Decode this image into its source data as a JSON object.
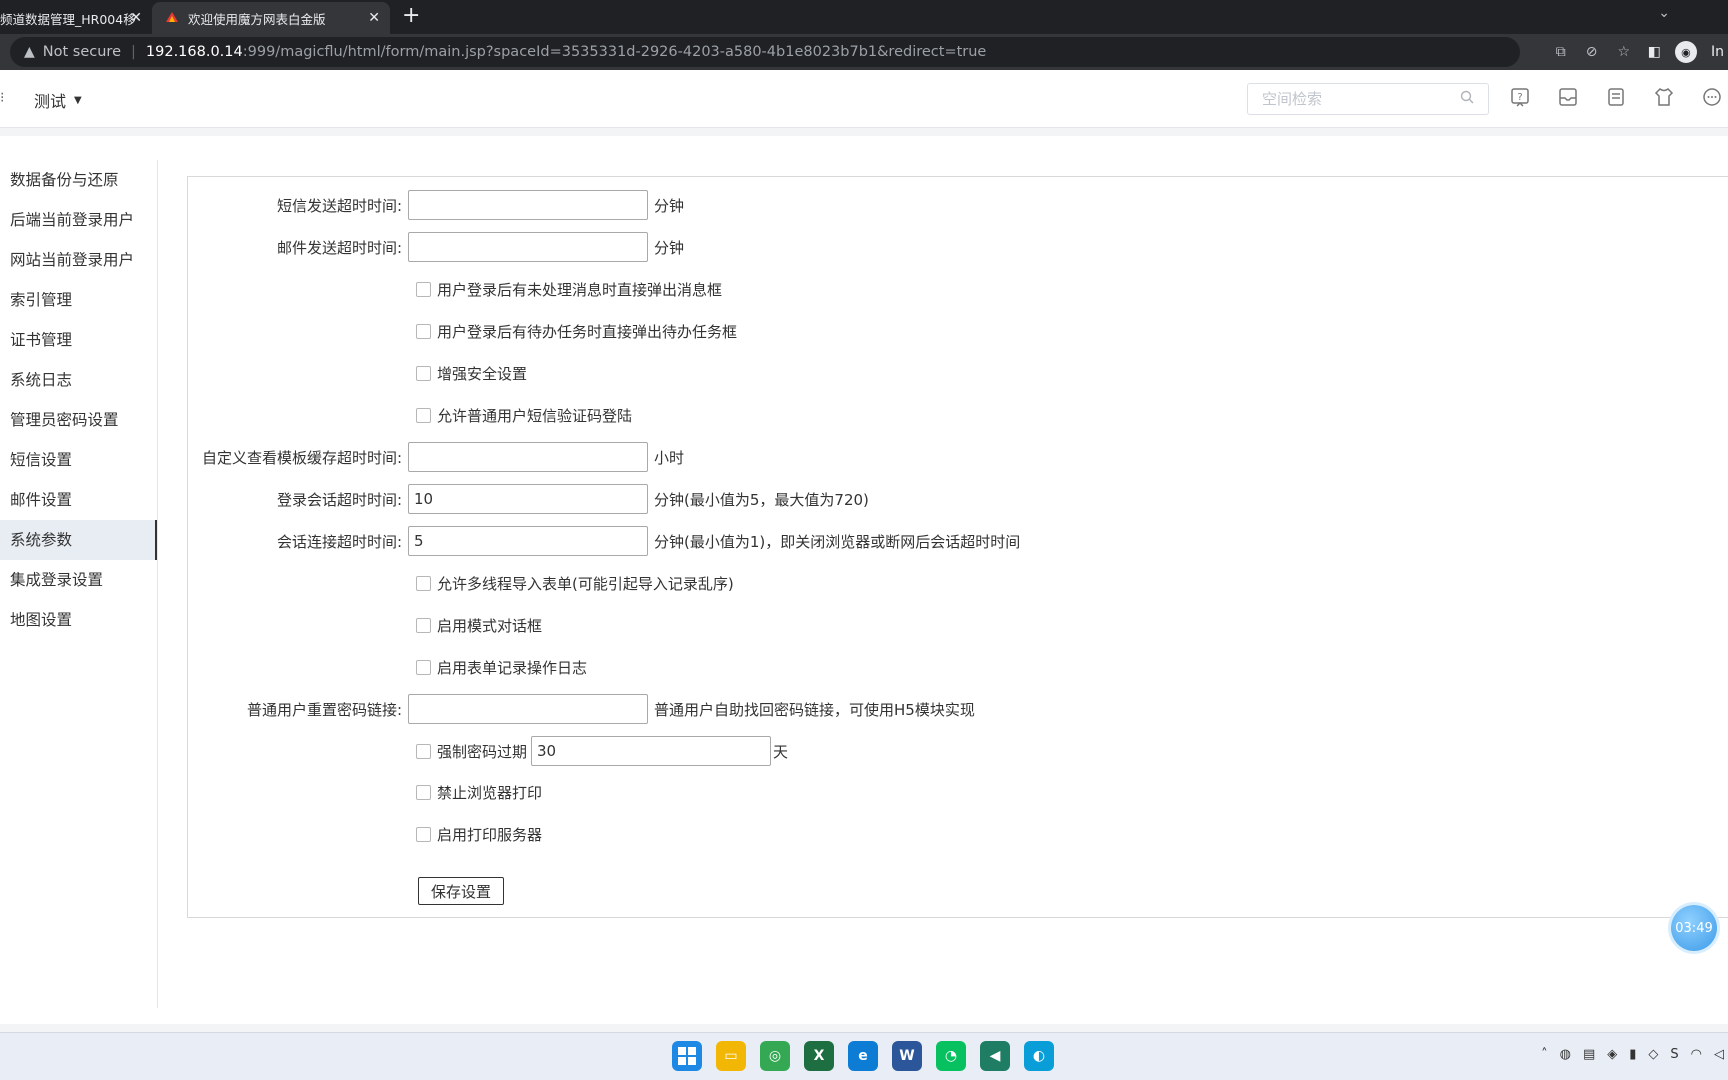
{
  "browser": {
    "tabs": [
      {
        "title": "频道数据管理_HR004移"
      },
      {
        "title": "欢迎使用魔方网表白金版"
      }
    ],
    "new_tab": "+",
    "address": {
      "security_label": "Not secure",
      "host": "192.168.0.14",
      "path": ":999/magicflu/html/form/main.jsp?spaceId=3535331d-2926-4203-a580-4b1e8023b7b1&redirect=true"
    },
    "profile_initial": "In"
  },
  "header": {
    "space_name": "测试",
    "search_placeholder": "空间检索"
  },
  "sidebar": {
    "items": [
      {
        "label": "数据备份与还原"
      },
      {
        "label": "后端当前登录用户"
      },
      {
        "label": "网站当前登录用户"
      },
      {
        "label": "索引管理"
      },
      {
        "label": "证书管理"
      },
      {
        "label": "系统日志"
      },
      {
        "label": "管理员密码设置"
      },
      {
        "label": "短信设置"
      },
      {
        "label": "邮件设置"
      },
      {
        "label": "系统参数"
      },
      {
        "label": "集成登录设置"
      },
      {
        "label": "地图设置"
      }
    ],
    "active": "系统参数"
  },
  "form": {
    "sms_timeout": {
      "label": "短信发送超时时间:",
      "value": "",
      "unit": "分钟"
    },
    "mail_timeout": {
      "label": "邮件发送超时时间:",
      "value": "",
      "unit": "分钟"
    },
    "popup_messages": {
      "label": "用户登录后有未处理消息时直接弹出消息框",
      "checked": false
    },
    "popup_tasks": {
      "label": "用户登录后有待办任务时直接弹出待办任务框",
      "checked": false
    },
    "enhanced_security": {
      "label": "增强安全设置",
      "checked": false
    },
    "sms_login": {
      "label": "允许普通用户短信验证码登陆",
      "checked": false
    },
    "template_cache": {
      "label": "自定义查看模板缓存超时时间:",
      "value": "",
      "unit": "小时"
    },
    "session_timeout": {
      "label": "登录会话超时时间:",
      "value": "10",
      "unit": "分钟(最小值为5，最大值为720)"
    },
    "connection_timeout": {
      "label": "会话连接超时时间:",
      "value": "5",
      "unit": "分钟(最小值为1)，即关闭浏览器或断网后会话超时时间"
    },
    "multithread_import": {
      "label": "允许多线程导入表单(可能引起导入记录乱序)",
      "checked": false
    },
    "modal_dialog": {
      "label": "启用模式对话框",
      "checked": false
    },
    "form_log": {
      "label": "启用表单记录操作日志",
      "checked": false
    },
    "reset_password_link": {
      "label": "普通用户重置密码链接:",
      "value": "",
      "hint": "普通用户自助找回密码链接，可使用H5模块实现"
    },
    "password_expiry": {
      "label": "强制密码过期",
      "checked": false,
      "value": "30",
      "unit": "天"
    },
    "disable_print": {
      "label": "禁止浏览器打印",
      "checked": false
    },
    "print_server": {
      "label": "启用打印服务器",
      "checked": false
    },
    "save_label": "保存设置"
  },
  "timer": "03:49"
}
